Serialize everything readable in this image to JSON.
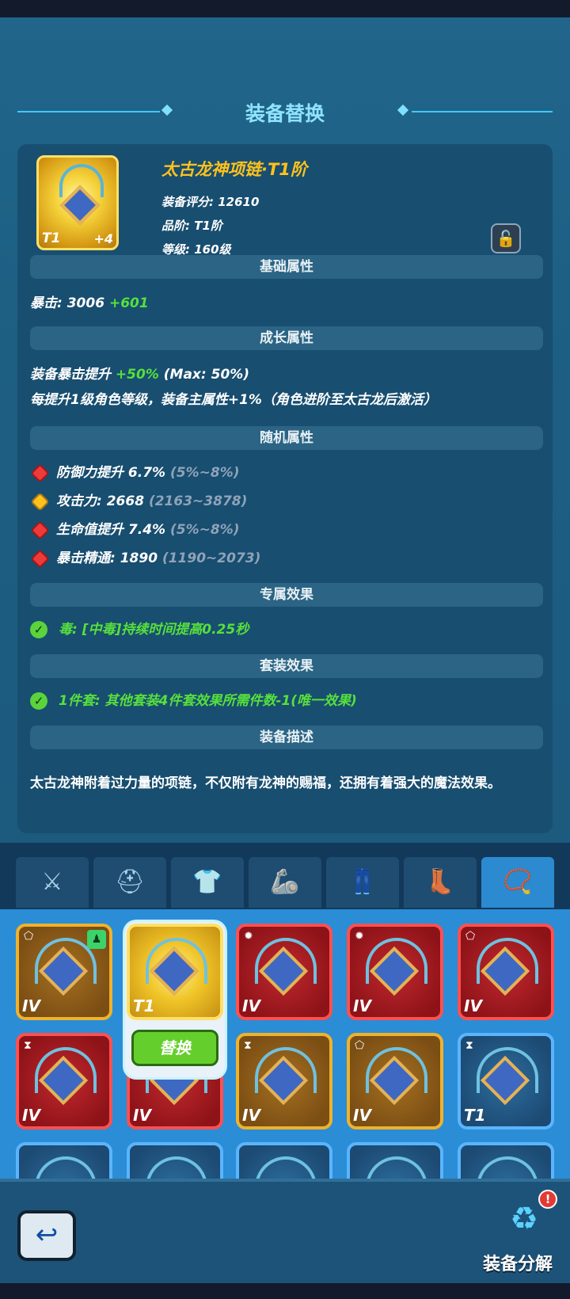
{
  "header": {
    "title": "装备替换"
  },
  "item": {
    "name": "太古龙神项链·T1阶",
    "tier_label": "T1",
    "plus_label": "+4",
    "score": "装备评分: 12610",
    "grade": "品阶: T1阶",
    "level": "等级: 160级"
  },
  "sections": {
    "base": "基础属性",
    "growth": "成长属性",
    "random": "随机属性",
    "exclusive": "专属效果",
    "set": "套装效果",
    "desc": "装备描述"
  },
  "base_attr": {
    "label": "暴击: 3006 ",
    "bonus": "+601"
  },
  "growth_attrs": {
    "line1_a": "装备暴击提升 ",
    "line1_b": "+50%",
    "line1_c": " (Max: 50%)",
    "line2": "每提升1级角色等级，装备主属性+1%（角色进阶至太古龙后激活）"
  },
  "random_attrs": [
    {
      "text": "防御力提升 6.7% ",
      "range": "(5%~8%)",
      "color": "red"
    },
    {
      "text": "攻击力: 2668 ",
      "range": "(2163~3878)",
      "color": "gold"
    },
    {
      "text": "生命值提升 7.4% ",
      "range": "(5%~8%)",
      "color": "red"
    },
    {
      "text": "暴击精通: 1890 ",
      "range": "(1190~2073)",
      "color": "red"
    }
  ],
  "exclusive_effect": "毒: [中毒]持续时间提高0.25秒",
  "set_effect": "1件套: 其他套装4件套效果所需件数-1(唯一效果)",
  "description": "太古龙神附着过力量的项链，不仅附有龙神的赐福，还拥有着强大的魔法效果。",
  "tabs": [
    "sword-icon",
    "helmet-icon",
    "armor-icon",
    "bracer-icon",
    "pants-icon",
    "boots-icon",
    "necklace-icon"
  ],
  "inventory_row1": [
    {
      "rarity": "brown",
      "tier": "IV",
      "tag": "⬠",
      "badge": "♟"
    },
    {
      "rarity": "gold",
      "tier": "T1",
      "tag": "",
      "selected": true
    },
    {
      "rarity": "red",
      "tier": "IV",
      "tag": "✹"
    },
    {
      "rarity": "red",
      "tier": "IV",
      "tag": "✹"
    },
    {
      "rarity": "red",
      "tier": "IV",
      "tag": "⬠"
    }
  ],
  "inventory_row2": [
    {
      "rarity": "red",
      "tier": "IV",
      "tag": "⧗"
    },
    {
      "rarity": "red",
      "tier": "IV",
      "tag": ""
    },
    {
      "rarity": "brown",
      "tier": "IV",
      "tag": "⧗"
    },
    {
      "rarity": "brown",
      "tier": "IV",
      "tag": "⬠"
    },
    {
      "rarity": "blue",
      "tier": "T1",
      "tag": "⧗"
    }
  ],
  "replace_label": "替换",
  "bottom": {
    "decompose_label": "装备分解",
    "alert": "!"
  },
  "colors": {
    "accent_gold": "#ffc21c",
    "green": "#56e03c",
    "title_cyan": "#8fe3ff"
  }
}
